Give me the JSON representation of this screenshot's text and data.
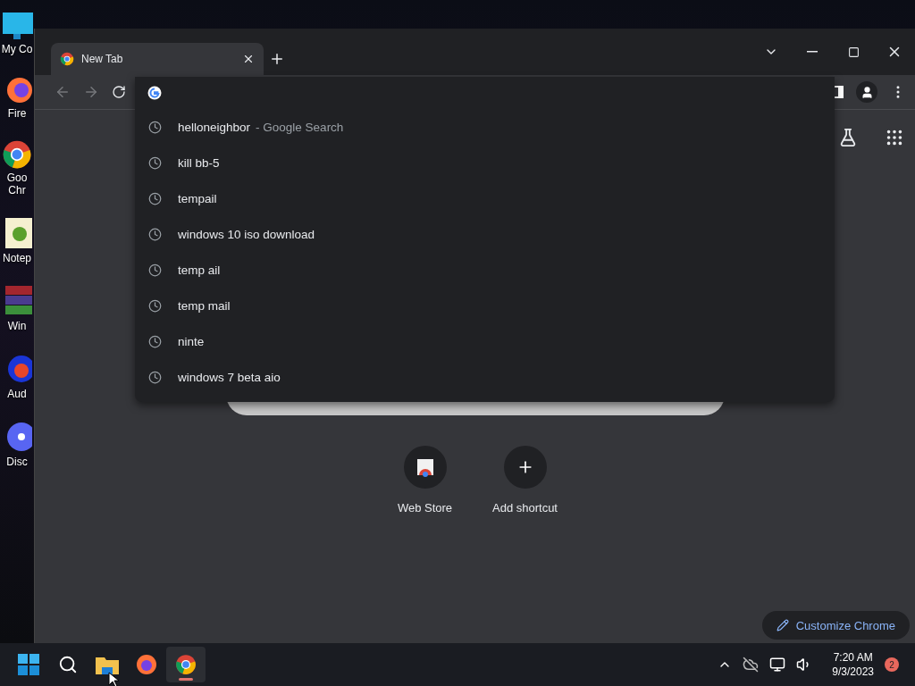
{
  "desktop_icons": [
    {
      "kind": "computer",
      "label": "My Co"
    },
    {
      "kind": "firefox",
      "label": "Fire"
    },
    {
      "kind": "chrome",
      "label": "Goo\nChr"
    },
    {
      "kind": "notepad",
      "label": "Notep"
    },
    {
      "kind": "winrar",
      "label": "Win"
    },
    {
      "kind": "audio",
      "label": "Aud"
    },
    {
      "kind": "discord",
      "label": "Disc"
    }
  ],
  "tabs": [
    {
      "title": "New Tab",
      "selected": true
    }
  ],
  "omnibox": {
    "suggestions": [
      {
        "text": "helloneighbor",
        "detail": "- Google Search"
      },
      {
        "text": "kill bb-5"
      },
      {
        "text": "tempail"
      },
      {
        "text": "windows 10 iso download"
      },
      {
        "text": "temp ail"
      },
      {
        "text": "temp mail"
      },
      {
        "text": "ninte"
      },
      {
        "text": "windows 7 beta aio"
      }
    ]
  },
  "shortcuts": [
    {
      "kind": "webstore",
      "label": "Web Store"
    },
    {
      "kind": "add",
      "label": "Add shortcut"
    }
  ],
  "customize_button": "Customize Chrome",
  "taskbar": {
    "apps": [
      {
        "kind": "start",
        "selected": false
      },
      {
        "kind": "search",
        "selected": false
      },
      {
        "kind": "explorer",
        "selected": false
      },
      {
        "kind": "firefox",
        "selected": false
      },
      {
        "kind": "chrome",
        "selected": true
      }
    ],
    "time": "7:20 AM",
    "date": "9/3/2023",
    "notifications": "2"
  }
}
